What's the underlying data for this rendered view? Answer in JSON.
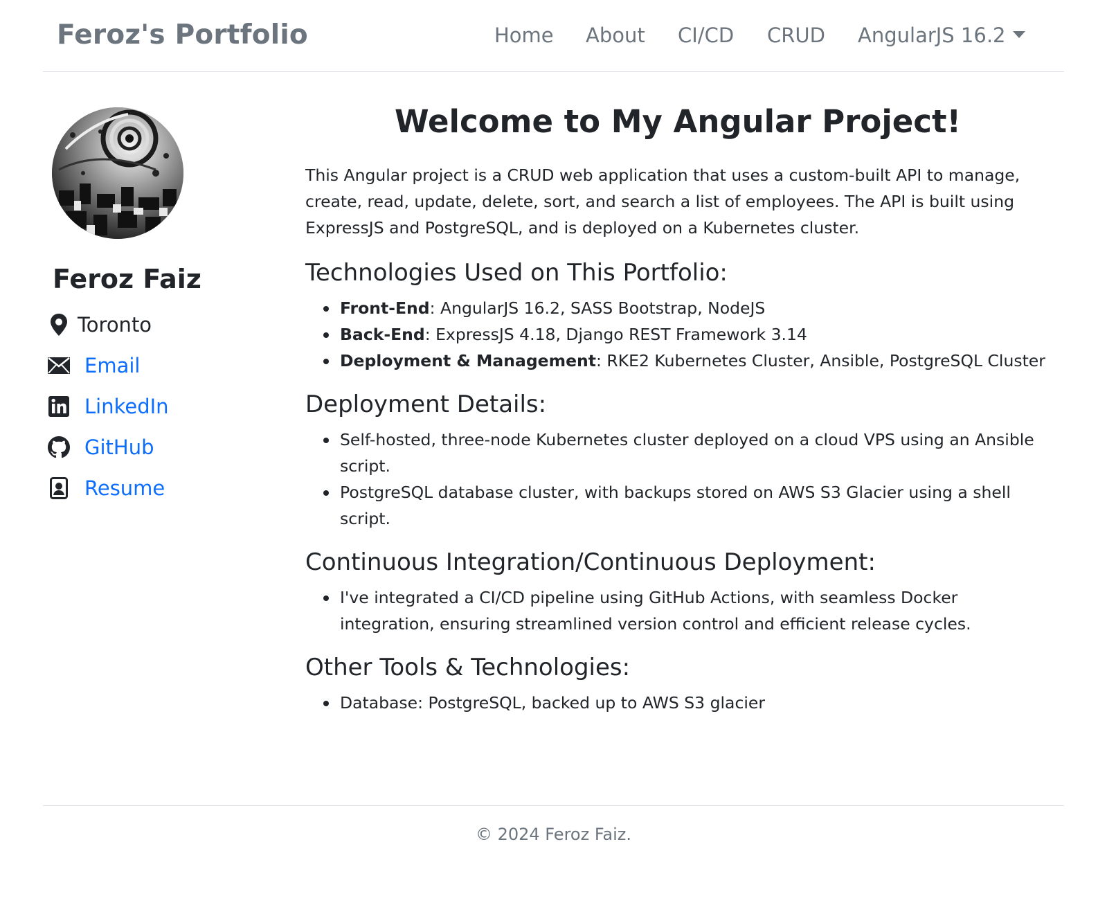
{
  "navbar": {
    "brand": "Feroz's Portfolio",
    "items": [
      {
        "label": "Home"
      },
      {
        "label": "About"
      },
      {
        "label": "CI/CD"
      },
      {
        "label": "CRUD"
      },
      {
        "label": "AngularJS 16.2"
      }
    ]
  },
  "sidebar": {
    "name": "Feroz Faiz",
    "location": "Toronto",
    "links": [
      {
        "label": "Email",
        "icon": "envelope-icon"
      },
      {
        "label": "LinkedIn",
        "icon": "linkedin-icon"
      },
      {
        "label": "GitHub",
        "icon": "github-icon"
      },
      {
        "label": "Resume",
        "icon": "person-badge-icon"
      }
    ]
  },
  "main": {
    "title": "Welcome to My Angular Project!",
    "intro": "This Angular project is a CRUD web application that uses a custom-built API to manage, create, read, update, delete, sort, and search a list of employees. The API is built using ExpressJS and PostgreSQL, and is deployed on a Kubernetes cluster.",
    "sections": [
      {
        "heading": "Technologies Used on This Portfolio:",
        "items": [
          {
            "bold": "Front-End",
            "text": ": AngularJS 16.2, SASS Bootstrap, NodeJS"
          },
          {
            "bold": "Back-End",
            "text": ": ExpressJS 4.18, Django REST Framework 3.14"
          },
          {
            "bold": "Deployment & Management",
            "text": ": RKE2 Kubernetes Cluster, Ansible, PostgreSQL Cluster"
          }
        ]
      },
      {
        "heading": "Deployment Details:",
        "items": [
          {
            "text": "Self-hosted, three-node Kubernetes cluster deployed on a cloud VPS using an Ansible script."
          },
          {
            "text": "PostgreSQL database cluster, with backups stored on AWS S3 Glacier using a shell script."
          }
        ]
      },
      {
        "heading": "Continuous Integration/Continuous Deployment:",
        "items": [
          {
            "text": "I've integrated a CI/CD pipeline using GitHub Actions, with seamless Docker integration, ensuring streamlined version control and efficient release cycles."
          }
        ]
      },
      {
        "heading": "Other Tools & Technologies:",
        "items": [
          {
            "text": "Database: PostgreSQL, backed up to AWS S3 glacier"
          }
        ]
      }
    ]
  },
  "footer": {
    "text": "© 2024 Feroz Faiz."
  },
  "colors": {
    "link": "#0d6efd",
    "muted": "#6c757d",
    "text": "#212529"
  }
}
